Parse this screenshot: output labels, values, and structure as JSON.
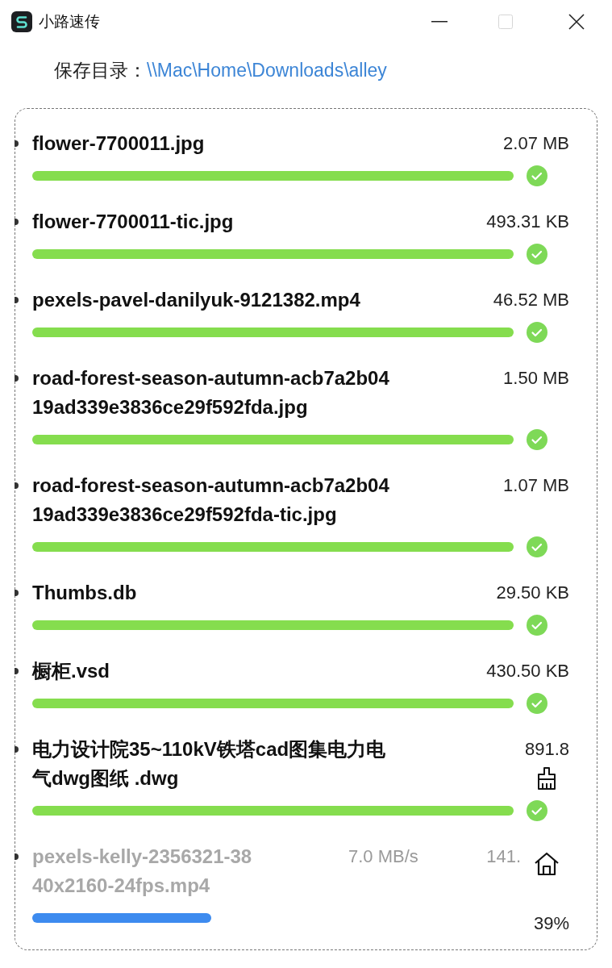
{
  "window": {
    "title": "小路速传"
  },
  "save_dir": {
    "label": "保存目录：",
    "path": "\\\\Mac\\Home\\Downloads\\alley"
  },
  "files": [
    {
      "kind": "done",
      "name": "flower-7700011.jpg",
      "size": "2.07 MB"
    },
    {
      "kind": "done",
      "name": "flower-7700011-tic.jpg",
      "size": "493.31 KB"
    },
    {
      "kind": "done",
      "name": "pexels-pavel-danilyuk-9121382.mp4",
      "size": "46.52 MB"
    },
    {
      "kind": "done",
      "name": "road-forest-season-autumn-acb7a2b0419ad339e3836ce29f592fda.jpg",
      "size": "1.50 MB"
    },
    {
      "kind": "done",
      "name": "road-forest-season-autumn-acb7a2b0419ad339e3836ce29f592fda-tic.jpg",
      "size": "1.07 MB"
    },
    {
      "kind": "done",
      "name": "Thumbs.db",
      "size": "29.50 KB"
    },
    {
      "kind": "done",
      "name": "橱柜.vsd",
      "size": "430.50 KB"
    },
    {
      "kind": "done",
      "name": "电力设计院35~110kV铁塔cad图集电力电气dwg图纸 .dwg",
      "size": "891.8"
    },
    {
      "kind": "active",
      "name": "pexels-kelly-2356321-3840x2160-24fps.mp4",
      "speed": "7.0 MB/s",
      "size": "141.",
      "percent": "39%"
    }
  ]
}
